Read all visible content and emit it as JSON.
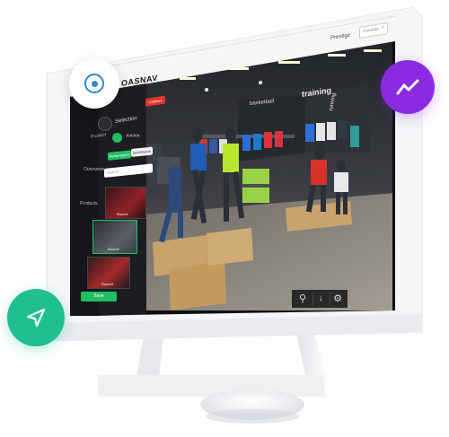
{
  "top_bar": {
    "logo_text": "OASNAV",
    "menu_item": "Prestige",
    "dropdown_label": "Favorite"
  },
  "sidebar": {
    "nav_items": [
      {
        "label": "Product"
      },
      {
        "label": "Outerwear"
      },
      {
        "label": "Products"
      }
    ],
    "close_label": "Outlines"
  },
  "panel": {
    "title": "Selection",
    "tabs": [
      {
        "label": "Performance",
        "active": true
      },
      {
        "label": "Sportswear",
        "active": false
      }
    ],
    "search_placeholder": "Search...",
    "thumbnails": [
      {
        "label": "Room1"
      },
      {
        "label": "Room2"
      },
      {
        "label": "Room3"
      }
    ],
    "save_label": "Save"
  },
  "store_signs": {
    "basketball": "basketball",
    "training": "training",
    "running": "running"
  },
  "toolbar": [
    {
      "icon": "search-icon"
    },
    {
      "icon": "download-icon"
    },
    {
      "icon": "settings-icon"
    }
  ],
  "floating_buttons": [
    {
      "icon": "target-icon",
      "color": "#ffffff"
    },
    {
      "icon": "analytics-icon",
      "color": "#8a2be2"
    },
    {
      "icon": "navigate-icon",
      "color": "#1fbf8f"
    }
  ],
  "colors": {
    "accent_green": "#1fbf63",
    "accent_red": "#e0332b",
    "panel_dark": "#141619",
    "monitor_white": "#f4f5f7"
  }
}
